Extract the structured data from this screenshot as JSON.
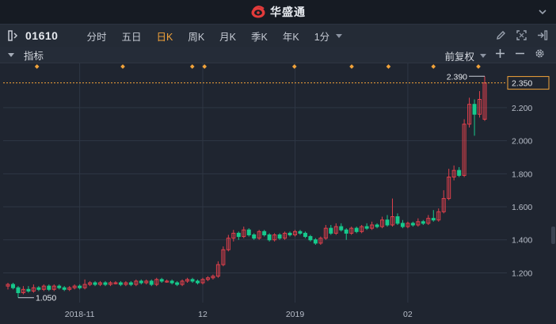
{
  "app": {
    "brand_name": "华盛通"
  },
  "toolbar": {
    "symbol": "01610",
    "periods": [
      "分时",
      "五日",
      "日K",
      "周K",
      "月K",
      "季K",
      "年K",
      "1分"
    ],
    "active_period": "日K"
  },
  "indicator_bar": {
    "label": "指标",
    "adjust_label": "前复权"
  },
  "colors": {
    "up": "#e0404c",
    "down": "#17c98c",
    "accent": "#f2a33a",
    "background": "#1f2530",
    "grid": "#2f3744",
    "marker": "#f2a33a"
  },
  "icons": [
    "logo-icon",
    "expand-panel-icon",
    "pen-icon",
    "fullscreen-icon",
    "exit-icon",
    "plus-icon",
    "minus-icon",
    "gear-icon",
    "chevron-down-icon"
  ],
  "chart_data": {
    "type": "candlestick",
    "y_ticks": [
      "2.350",
      "2.200",
      "2.000",
      "1.800",
      "1.600",
      "1.400",
      "1.200"
    ],
    "current_price_tag": "2.350",
    "x_ticks": [
      "2018-11",
      "12",
      "2019",
      "02"
    ],
    "annotations": {
      "high": "2.390",
      "low": "1.050"
    },
    "ylim": [
      1.02,
      2.42
    ],
    "marker_count": 9,
    "candles": [
      [
        1.12,
        1.13,
        1.1,
        1.14
      ],
      [
        1.13,
        1.11,
        1.1,
        1.14
      ],
      [
        1.11,
        1.08,
        1.05,
        1.12
      ],
      [
        1.08,
        1.1,
        1.07,
        1.12
      ],
      [
        1.1,
        1.09,
        1.08,
        1.12
      ],
      [
        1.09,
        1.11,
        1.08,
        1.13
      ],
      [
        1.11,
        1.1,
        1.09,
        1.12
      ],
      [
        1.1,
        1.12,
        1.09,
        1.13
      ],
      [
        1.12,
        1.1,
        1.09,
        1.13
      ],
      [
        1.1,
        1.12,
        1.09,
        1.13
      ],
      [
        1.12,
        1.11,
        1.1,
        1.13
      ],
      [
        1.11,
        1.1,
        1.09,
        1.12
      ],
      [
        1.1,
        1.11,
        1.09,
        1.12
      ],
      [
        1.11,
        1.12,
        1.1,
        1.13
      ],
      [
        1.12,
        1.11,
        1.1,
        1.13
      ],
      [
        1.11,
        1.13,
        1.1,
        1.16
      ],
      [
        1.13,
        1.14,
        1.12,
        1.15
      ],
      [
        1.14,
        1.13,
        1.12,
        1.15
      ],
      [
        1.13,
        1.14,
        1.12,
        1.15
      ],
      [
        1.14,
        1.13,
        1.12,
        1.15
      ],
      [
        1.13,
        1.14,
        1.12,
        1.15
      ],
      [
        1.14,
        1.14,
        1.13,
        1.15
      ],
      [
        1.14,
        1.13,
        1.12,
        1.15
      ],
      [
        1.13,
        1.14,
        1.12,
        1.15
      ],
      [
        1.14,
        1.13,
        1.12,
        1.15
      ],
      [
        1.13,
        1.15,
        1.12,
        1.16
      ],
      [
        1.15,
        1.14,
        1.13,
        1.16
      ],
      [
        1.14,
        1.15,
        1.13,
        1.16
      ],
      [
        1.15,
        1.13,
        1.12,
        1.16
      ],
      [
        1.13,
        1.16,
        1.12,
        1.17
      ],
      [
        1.16,
        1.15,
        1.14,
        1.17
      ],
      [
        1.15,
        1.15,
        1.14,
        1.16
      ],
      [
        1.15,
        1.14,
        1.13,
        1.16
      ],
      [
        1.14,
        1.13,
        1.12,
        1.15
      ],
      [
        1.13,
        1.15,
        1.12,
        1.16
      ],
      [
        1.15,
        1.16,
        1.14,
        1.17
      ],
      [
        1.16,
        1.15,
        1.14,
        1.17
      ],
      [
        1.15,
        1.14,
        1.13,
        1.16
      ],
      [
        1.14,
        1.16,
        1.13,
        1.17
      ],
      [
        1.16,
        1.17,
        1.15,
        1.18
      ],
      [
        1.17,
        1.18,
        1.16,
        1.19
      ],
      [
        1.18,
        1.25,
        1.17,
        1.27
      ],
      [
        1.25,
        1.34,
        1.24,
        1.36
      ],
      [
        1.34,
        1.41,
        1.33,
        1.43
      ],
      [
        1.41,
        1.44,
        1.39,
        1.46
      ],
      [
        1.44,
        1.42,
        1.4,
        1.45
      ],
      [
        1.42,
        1.46,
        1.41,
        1.48
      ],
      [
        1.46,
        1.43,
        1.42,
        1.47
      ],
      [
        1.43,
        1.41,
        1.4,
        1.44
      ],
      [
        1.41,
        1.45,
        1.4,
        1.46
      ],
      [
        1.45,
        1.43,
        1.42,
        1.46
      ],
      [
        1.43,
        1.4,
        1.39,
        1.44
      ],
      [
        1.4,
        1.43,
        1.39,
        1.44
      ],
      [
        1.43,
        1.41,
        1.4,
        1.44
      ],
      [
        1.41,
        1.44,
        1.4,
        1.45
      ],
      [
        1.44,
        1.43,
        1.42,
        1.45
      ],
      [
        1.43,
        1.45,
        1.42,
        1.46
      ],
      [
        1.45,
        1.44,
        1.43,
        1.46
      ],
      [
        1.44,
        1.42,
        1.41,
        1.45
      ],
      [
        1.42,
        1.4,
        1.39,
        1.43
      ],
      [
        1.4,
        1.38,
        1.37,
        1.41
      ],
      [
        1.38,
        1.41,
        1.37,
        1.42
      ],
      [
        1.41,
        1.47,
        1.4,
        1.49
      ],
      [
        1.47,
        1.44,
        1.43,
        1.49
      ],
      [
        1.44,
        1.48,
        1.43,
        1.5
      ],
      [
        1.48,
        1.46,
        1.45,
        1.5
      ],
      [
        1.46,
        1.44,
        1.4,
        1.47
      ],
      [
        1.44,
        1.47,
        1.43,
        1.48
      ],
      [
        1.47,
        1.45,
        1.44,
        1.48
      ],
      [
        1.45,
        1.48,
        1.44,
        1.49
      ],
      [
        1.48,
        1.47,
        1.46,
        1.5
      ],
      [
        1.47,
        1.49,
        1.46,
        1.51
      ],
      [
        1.49,
        1.48,
        1.47,
        1.5
      ],
      [
        1.48,
        1.52,
        1.47,
        1.54
      ],
      [
        1.52,
        1.49,
        1.48,
        1.55
      ],
      [
        1.49,
        1.54,
        1.48,
        1.65
      ],
      [
        1.54,
        1.5,
        1.49,
        1.56
      ],
      [
        1.5,
        1.48,
        1.47,
        1.52
      ],
      [
        1.48,
        1.5,
        1.47,
        1.51
      ],
      [
        1.5,
        1.49,
        1.48,
        1.51
      ],
      [
        1.49,
        1.51,
        1.48,
        1.53
      ],
      [
        1.51,
        1.5,
        1.49,
        1.52
      ],
      [
        1.5,
        1.53,
        1.49,
        1.55
      ],
      [
        1.53,
        1.52,
        1.51,
        1.58
      ],
      [
        1.52,
        1.57,
        1.51,
        1.59
      ],
      [
        1.57,
        1.65,
        1.56,
        1.7
      ],
      [
        1.65,
        1.78,
        1.64,
        1.83
      ],
      [
        1.78,
        1.82,
        1.76,
        1.85
      ],
      [
        1.82,
        1.79,
        1.78,
        1.84
      ],
      [
        1.79,
        2.1,
        1.78,
        2.13
      ],
      [
        2.1,
        2.22,
        2.08,
        2.26
      ],
      [
        2.22,
        2.16,
        2.03,
        2.25
      ],
      [
        2.16,
        2.25,
        2.14,
        2.3
      ],
      [
        2.13,
        2.35,
        2.12,
        2.39
      ]
    ]
  }
}
